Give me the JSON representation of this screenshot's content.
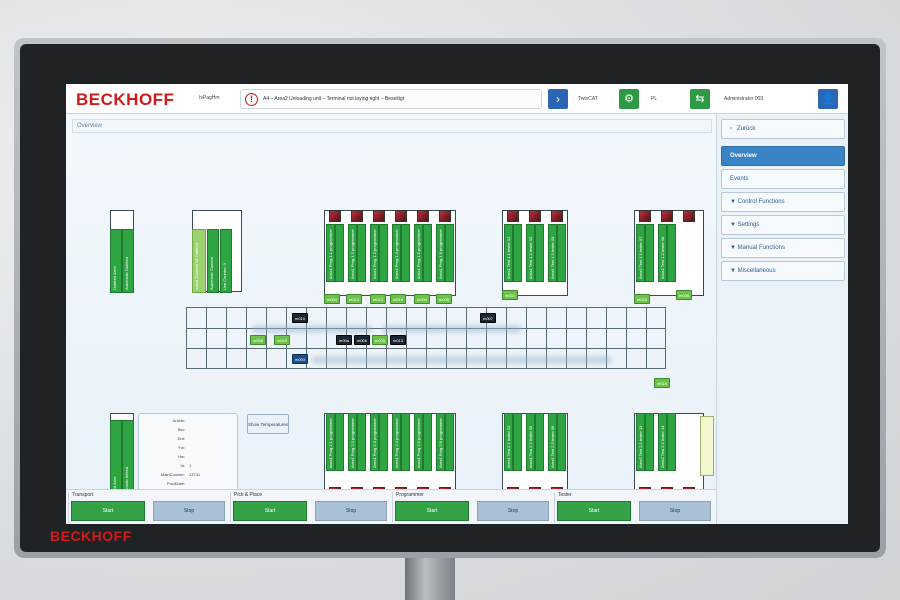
{
  "header": {
    "logo": "BECKHOFF",
    "location": "IsPagHm",
    "alarm_text": "A4 – Area2 Unloading unit – Terminal not laying right – Beseitigt",
    "next_icon": "chevron-right-icon",
    "twincat_label": "TwinCAT",
    "plc_label": "PL",
    "user_label": "Administrator 003"
  },
  "nav": {
    "back": "Zurück",
    "items": [
      "Overview",
      "Events",
      "▼ Control Functions",
      "▼ Settings",
      "▼ Manual Functions",
      "▼ Miscellaneous"
    ]
  },
  "overview": {
    "title": "Overview",
    "cols_left": [
      "Outfeed Area",
      "Automatic Outfeed",
      "Infeed Area",
      "Automatic Infeed"
    ],
    "cols_cam": [
      "Area1 Camera 01 Outfeed",
      "Automatic Camera",
      "Use Counter: 0"
    ],
    "prog_top": [
      "Area1 Prog 1.1 programmer 01",
      "Area1 Prog 1.2 programmer 02",
      "Area1 Prog 1.3 programmer 03",
      "Area1 Prog 1.4 programmer 04",
      "Area1 Prog 1.5 programmer 05",
      "Area1 Prog 1.6 programmer 06"
    ],
    "prog_bot": [
      "Area1 Prog 2.1 programmer 07",
      "Area1 Prog 2.2 programmer 08",
      "Area1 Prog 2.3 programmer 09",
      "Area1 Prog 2.4 programmer 10",
      "Area1 Prog 2.5 programmer 11",
      "Area1 Prog 2.6 programmer 12"
    ],
    "test_top": [
      "Area1 Test 1.1 tester 01",
      "Area1 Test 1.2 tester 02",
      "Area1 Test 1.3 tester 03"
    ],
    "test_bot": [
      "Area1 Test 2.1 tester 04",
      "Area1 Test 2.2 tester 05",
      "Area1 Test 2.3 tester 06"
    ],
    "test_r_top": [
      "Area2 Test 1.1 tester 07",
      "Area2 Test 1.2 tester 08"
    ],
    "test_r_bot": [
      "Area2 Test 2.1 tester 13",
      "Area2 Test 2.2 tester 14"
    ],
    "tags_top": [
      "m004",
      "m014",
      "m012",
      "m016",
      "m004",
      "m005",
      "m002",
      "m026",
      "m008"
    ],
    "tags_row": [
      "m010",
      "m003",
      "m00a",
      "m00b",
      "m009",
      "m013",
      "m007"
    ],
    "tags_extra": [
      "m008",
      "m019",
      "m016"
    ],
    "info": {
      "rows": [
        {
          "label": "Article:",
          "value": ""
        },
        {
          "label": "Bto:",
          "value": ""
        },
        {
          "label": "Dut:",
          "value": ""
        },
        {
          "label": "Fw:",
          "value": ""
        },
        {
          "label": "Hw:",
          "value": ""
        },
        {
          "label": "Id:",
          "value": "1"
        },
        {
          "label": "MainCounter:",
          "value": "13741"
        },
        {
          "label": "ProdDate:",
          "value": ""
        },
        {
          "label": "RevNr:",
          "value": ""
        }
      ]
    },
    "temp_button": "Show Temperatures"
  },
  "bottom": {
    "groups": [
      {
        "label": "Transport",
        "start": "Start",
        "stop": "Stop"
      },
      {
        "label": "Pick & Place",
        "start": "Start",
        "stop": "Stop"
      },
      {
        "label": "Programmer",
        "start": "Start",
        "stop": "Stop"
      },
      {
        "label": "Tester",
        "start": "Start",
        "stop": "Stop"
      }
    ]
  },
  "bezel_logo": "BECKHOFF",
  "colors": {
    "brand": "#d11a1a",
    "accent": "#3a83c4",
    "ok": "#2fa442"
  }
}
